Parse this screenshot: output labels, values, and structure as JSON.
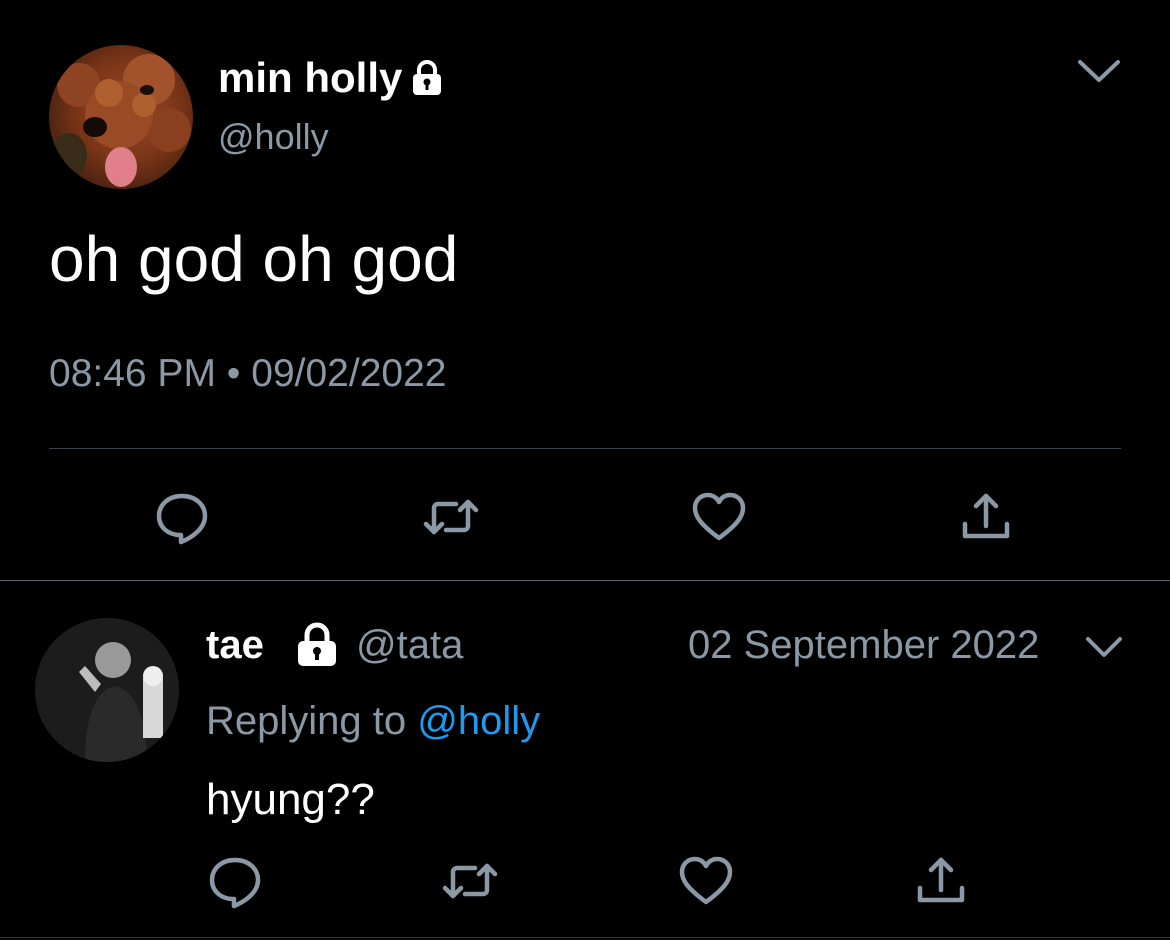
{
  "main_tweet": {
    "display_name": "min holly",
    "handle": "@holly",
    "text": "oh god oh god",
    "time": "08:46 PM",
    "separator": "•",
    "date": "09/02/2022",
    "avatar_icon": "dog-avatar",
    "locked_icon": "lock-icon"
  },
  "reply_tweet": {
    "display_name": "tae",
    "handle": "@tata",
    "date": "02 September 2022",
    "replying_prefix": "Replying to",
    "replying_handle": "@holly",
    "text": "hyung??",
    "avatar_icon": "person-avatar",
    "locked_icon": "lock-icon"
  },
  "actions": [
    "reply-icon",
    "retweet-icon",
    "like-icon",
    "share-icon"
  ],
  "colors": {
    "background": "#000000",
    "text": "#ffffff",
    "muted": "#8b98a5",
    "link": "#1d9bf0",
    "divider": "#38444d"
  }
}
